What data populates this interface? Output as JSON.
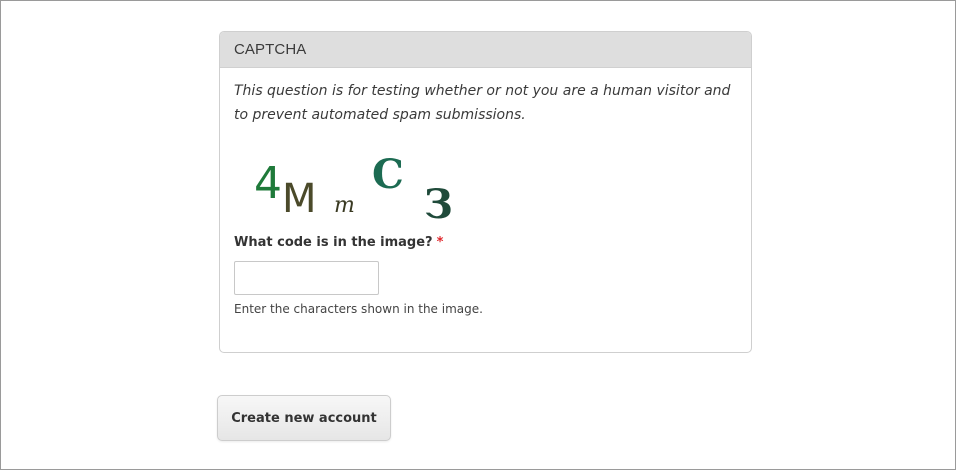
{
  "captcha": {
    "legend": "CAPTCHA",
    "description": "This question is for testing whether or not you are a human visitor and to prevent automated spam submissions.",
    "image_code": [
      "4",
      "M",
      "m",
      "C",
      "З"
    ],
    "image_colors": [
      "#1f7a3a",
      "#4b4a2a",
      "#3a3a22",
      "#1c6b52",
      "#1f4a3a"
    ],
    "field_label": "What code is in the image?",
    "required_marker": "*",
    "input_value": "",
    "help_text": "Enter the characters shown in the image."
  },
  "form": {
    "submit_label": "Create new account"
  }
}
